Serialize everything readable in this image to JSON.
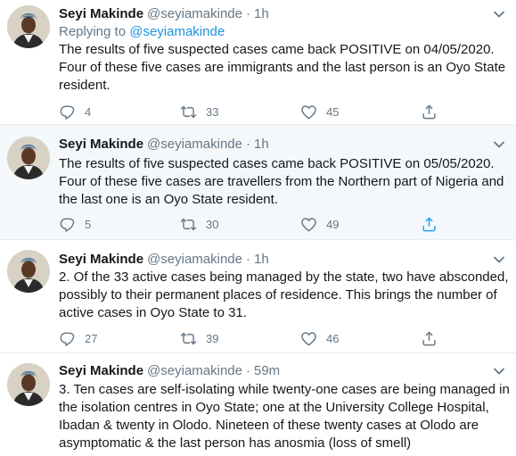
{
  "tweets": [
    {
      "name": "Seyi Makinde",
      "handle": "@seyiamakinde",
      "separator": "·",
      "time": "1h",
      "replying_prefix": "Replying to",
      "replying_to": "@seyiamakinde",
      "text": "The results of five suspected cases came back POSITIVE on 04/05/2020. Four of these five cases are immigrants and the last person is an Oyo State resident.",
      "replies": "4",
      "retweets": "33",
      "likes": "45"
    },
    {
      "name": "Seyi Makinde",
      "handle": "@seyiamakinde",
      "separator": "·",
      "time": "1h",
      "text": "The results of five suspected cases came back POSITIVE on 05/05/2020. Four of these five cases are travellers from the Northern part of Nigeria and the last one is an Oyo State resident.",
      "replies": "5",
      "retweets": "30",
      "likes": "49"
    },
    {
      "name": "Seyi Makinde",
      "handle": "@seyiamakinde",
      "separator": "·",
      "time": "1h",
      "text": "2. Of the 33 active cases being managed by the state, two have absconded, possibly to their permanent places of residence. This brings the number of active cases in Oyo State to 31.",
      "replies": "27",
      "retweets": "39",
      "likes": "46"
    },
    {
      "name": "Seyi Makinde",
      "handle": "@seyiamakinde",
      "separator": "·",
      "time": "59m",
      "text": "3. Ten cases are self-isolating while twenty-one cases are being managed in the isolation centres in Oyo State; one at the University College Hospital, Ibadan & twenty in Olodo. Nineteen of these twenty cases at Olodo are asymptomatic & the last person has anosmia (loss of smell)"
    }
  ],
  "colors": {
    "text": "#14171a",
    "secondary": "#657786",
    "link": "#1b95e0",
    "highlight_bg": "#f5f8fa",
    "divider": "#e6ecf0"
  },
  "icons": [
    "reply-icon",
    "retweet-icon",
    "like-icon",
    "share-icon",
    "chevron-down-icon"
  ]
}
